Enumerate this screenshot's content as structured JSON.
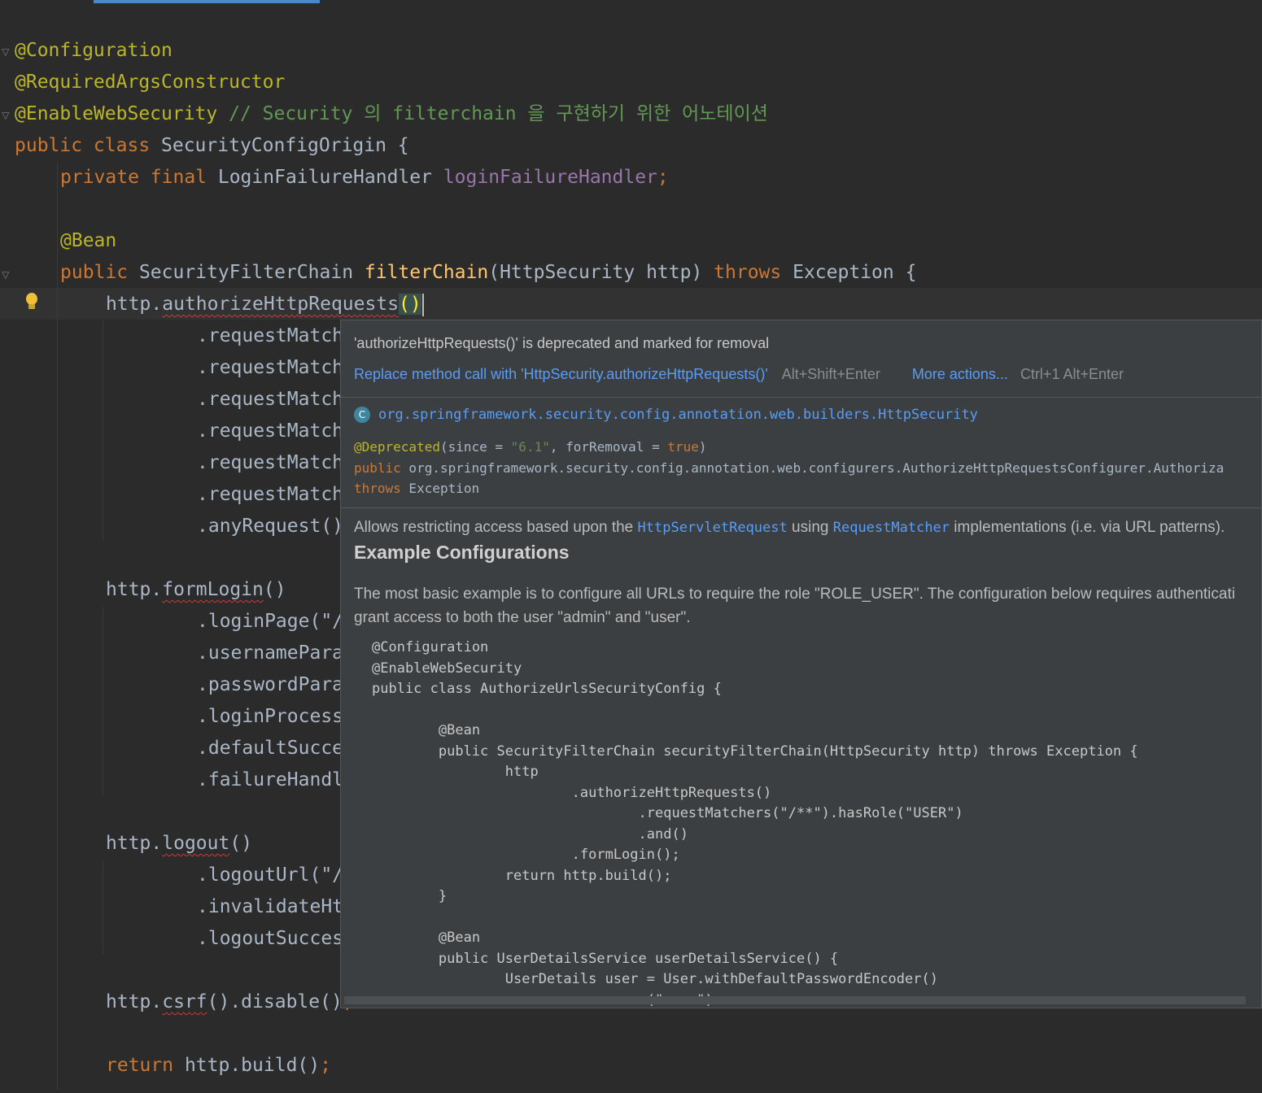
{
  "editor": {
    "lines": {
      "l1": "@Configuration",
      "l2": "@RequiredArgsConstructor",
      "l3_ann": "@EnableWebSecurity",
      "l3_comment": " // Security 의 filterchain 을 구현하기 위한 어노테이션",
      "l4_kw": "public class",
      "l4_name": " SecurityConfigOrigin {",
      "l5_kw": "private final",
      "l5_type": " LoginFailureHandler ",
      "l5_field": "loginFailureHandler",
      "l5_end": ";",
      "l7": "@Bean",
      "l8_kw": "public",
      "l8_type": " SecurityFilterChain ",
      "l8_fn": "filterChain",
      "l8_params": "(HttpSecurity http) ",
      "l8_throws": "throws",
      "l8_end": " Exception {",
      "l9_obj": "http.",
      "l9_method": "authorizeHttpRequests",
      "l9_parens": "()",
      "l10": ".requestMatch",
      "l11": ".requestMatch",
      "l12": ".requestMatch",
      "l13": ".requestMatch",
      "l14": ".requestMatch",
      "l15": ".requestMatch",
      "l16": ".anyRequest()",
      "l18_obj": "http.",
      "l18_method": "formLogin",
      "l18_end": "()",
      "l19": ".loginPage(\"/",
      "l20": ".usernamePara",
      "l21": ".passwordPara",
      "l22": ".loginProcess",
      "l23": ".defaultSucce",
      "l24": ".failureHandl",
      "l26_obj": "http.",
      "l26_method": "logout",
      "l26_end": "()",
      "l27": ".logoutUrl(\"/",
      "l28": ".invalidateHt",
      "l29": ".logoutSucces",
      "l31_obj": "http.",
      "l31_method": "csrf",
      "l31_end": "().disable()",
      "l31_semi": ";",
      "l33_kw": "return",
      "l33_rest": " http.build()",
      "l33_semi": ";"
    }
  },
  "popup": {
    "message": "'authorizeHttpRequests()' is deprecated and marked for removal",
    "fix_action": "Replace method call with 'HttpSecurity.authorizeHttpRequests()'",
    "fix_shortcut": "Alt+Shift+Enter",
    "more_actions": "More actions...",
    "more_shortcut": "Ctrl+1 Alt+Enter",
    "class_icon": "C",
    "class_name": "org.springframework.security.config.annotation.web.builders.HttpSecurity",
    "sig1_ann": "@Deprecated",
    "sig1_open": "(since = ",
    "sig1_since": "\"6.1\"",
    "sig1_mid": ", forRemoval = ",
    "sig1_true": "true",
    "sig1_close": ")",
    "sig2_kw": "public",
    "sig2_rest": " org.springframework.security.config.annotation.web.configurers.AuthorizeHttpRequestsConfigurer.Authoriza",
    "sig3_kw": "throws",
    "sig3_rest": " Exception",
    "desc_1": "Allows restricting access based upon the ",
    "desc_link1": "HttpServletRequest",
    "desc_2": " using ",
    "desc_link2": "RequestMatcher",
    "desc_3": " implementations (i.e. via URL patterns).",
    "heading": "Example Configurations",
    "para1": "The most basic example is to configure all URLs to require the role \"ROLE_USER\". The configuration below requires authenticati",
    "para2": "grant access to both the user \"admin\" and \"user\".",
    "code": {
      "c1": "@Configuration",
      "c2": "@EnableWebSecurity",
      "c3": "public class AuthorizeUrlsSecurityConfig {",
      "c5": "        @Bean",
      "c6": "        public SecurityFilterChain securityFilterChain(HttpSecurity http) throws Exception {",
      "c7": "                http",
      "c8": "                        .authorizeHttpRequests()",
      "c9": "                                .requestMatchers(\"/**\").hasRole(\"USER\")",
      "c10": "                                .and()",
      "c11": "                        .formLogin();",
      "c12": "                return http.build();",
      "c13": "        }",
      "c15": "        @Bean",
      "c16": "        public UserDetailsService userDetailsService() {",
      "c17": "                UserDetails user = User.withDefaultPasswordEncoder()",
      "c18": "                        .username(\"user\")"
    }
  }
}
